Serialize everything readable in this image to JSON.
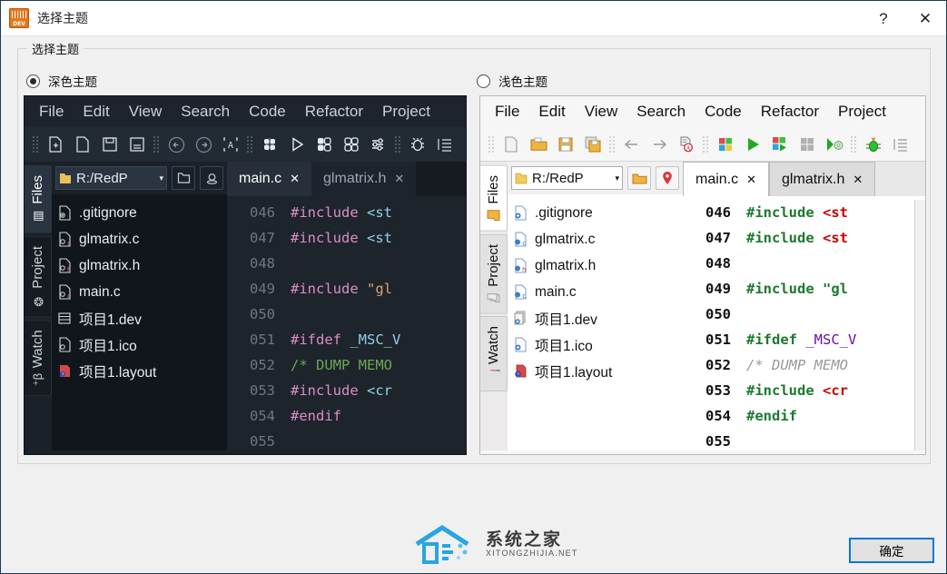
{
  "window": {
    "title": "选择主题",
    "app_icon": "dev-cpp-icon",
    "help_label": "?",
    "close_label": "✕"
  },
  "groupbox": {
    "legend": "选择主题"
  },
  "radios": [
    {
      "label": "深色主题",
      "selected": true,
      "name": "dark-theme"
    },
    {
      "label": "浅色主题",
      "selected": false,
      "name": "light-theme"
    }
  ],
  "preview": {
    "menubar": [
      "File",
      "Edit",
      "View",
      "Search",
      "Code",
      "Refactor",
      "Project"
    ],
    "toolbar_icons": [
      "new-file-icon",
      "open-file-icon",
      "save-icon",
      "save-all-icon",
      "back-icon",
      "forward-icon",
      "find-icon",
      "compile-icon",
      "run-icon",
      "compile-run-icon",
      "rebuild-icon",
      "settings-icon",
      "debug-icon",
      "indent-icon"
    ],
    "vtabs": [
      {
        "label": "Files",
        "icon": "folder-icon",
        "active": true
      },
      {
        "label": "Project",
        "icon": "project-icon",
        "active": false
      },
      {
        "label": "Watch",
        "icon": "watch-icon",
        "active": false
      }
    ],
    "path": {
      "value": "R:/RedP",
      "folder_icon": "folder-icon",
      "caret": "▾",
      "open_btn": "open-folder-icon",
      "locate_btn": "locate-icon"
    },
    "files": [
      {
        "name": ".gitignore",
        "icon": "file-icon"
      },
      {
        "name": "glmatrix.c",
        "icon": "c-file-icon"
      },
      {
        "name": "glmatrix.h",
        "icon": "h-file-icon"
      },
      {
        "name": "main.c",
        "icon": "c-file-icon"
      },
      {
        "name": "项目1.dev",
        "icon": "dev-project-icon"
      },
      {
        "name": "项目1.ico",
        "icon": "file-icon"
      },
      {
        "name": "项目1.layout",
        "icon": "layout-file-icon"
      }
    ],
    "tabs": [
      {
        "label": "main.c",
        "close": "✕",
        "active": true
      },
      {
        "label": "glmatrix.h",
        "close": "✕",
        "active": false
      }
    ],
    "gutter": [
      "046",
      "047",
      "048",
      "049",
      "050",
      "051",
      "052",
      "053",
      "054",
      "055"
    ],
    "code_lines": [
      [
        {
          "t": "#include ",
          "c": "k"
        },
        {
          "t": "<st",
          "c": "br"
        }
      ],
      [
        {
          "t": "#include ",
          "c": "k"
        },
        {
          "t": "<st",
          "c": "br"
        }
      ],
      [],
      [
        {
          "t": "#include ",
          "c": "k"
        },
        {
          "t": "\"gl",
          "c": "str"
        }
      ],
      [],
      [
        {
          "t": "#ifdef ",
          "c": "k"
        },
        {
          "t": "_MSC_V",
          "c": "mac"
        }
      ],
      [
        {
          "t": "/* DUMP MEMO",
          "c": "cm"
        }
      ],
      [
        {
          "t": "#include ",
          "c": "k"
        },
        {
          "t": "<cr",
          "c": "br"
        }
      ],
      [
        {
          "t": "#endif",
          "c": "k"
        }
      ],
      []
    ]
  },
  "watermark": {
    "cn": "系统之家",
    "en": "XITONGZHIJIA.NET",
    "logo": "house-logo"
  },
  "buttons": {
    "ok": "确定"
  },
  "colors": {
    "dialog_bg": "#f0f0f0",
    "accent": "#0078d7",
    "dark_panel_bg": "#1b2129",
    "dark_editor_bg": "#1e242c",
    "light_panel_bg": "#f6f6f6",
    "app_icon_orange": "#e8761b"
  }
}
